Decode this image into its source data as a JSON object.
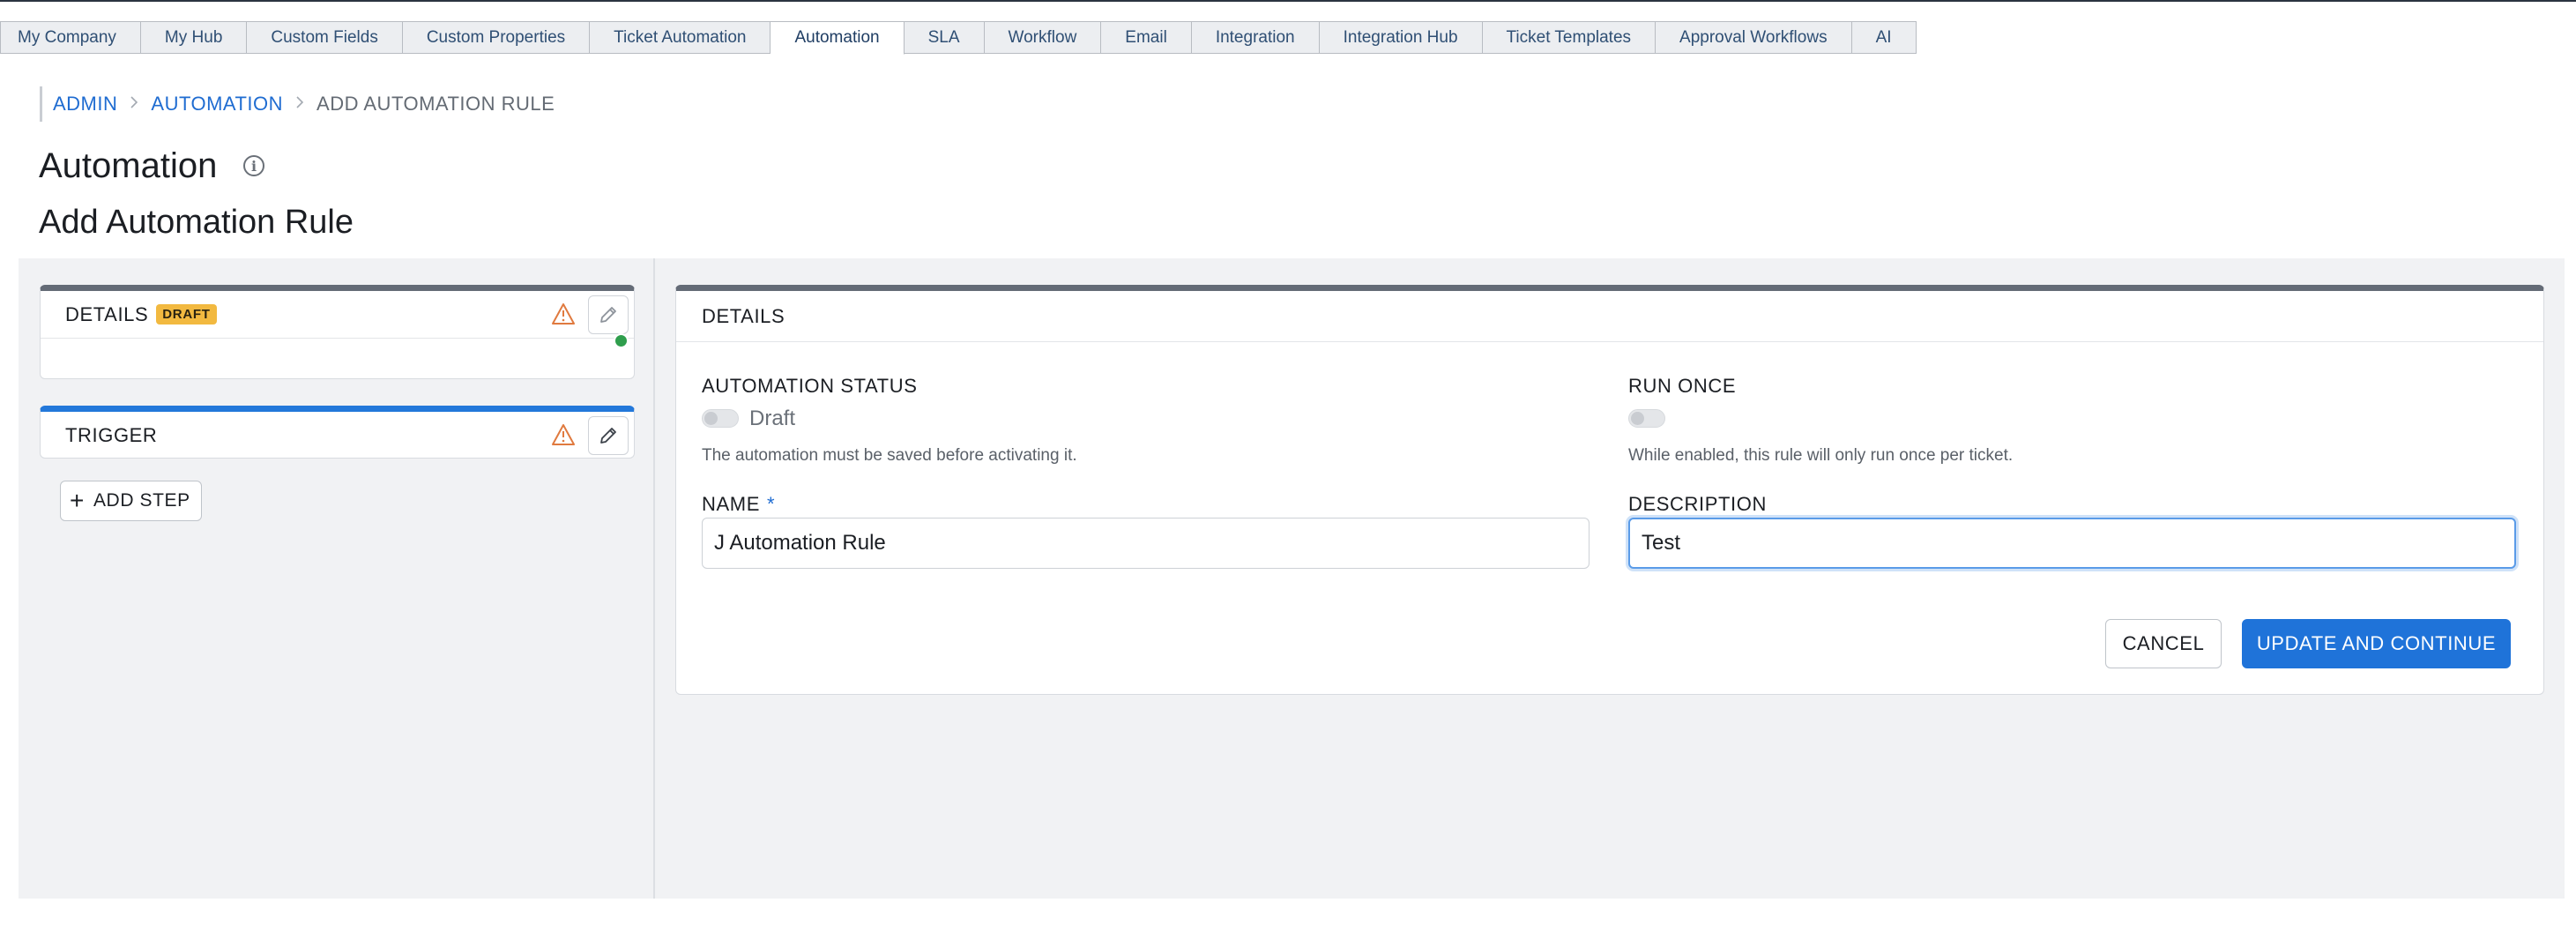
{
  "tabs": [
    {
      "label": "My Company",
      "active": false
    },
    {
      "label": "My Hub",
      "active": false
    },
    {
      "label": "Custom Fields",
      "active": false
    },
    {
      "label": "Custom Properties",
      "active": false
    },
    {
      "label": "Ticket Automation",
      "active": false
    },
    {
      "label": "Automation",
      "active": true
    },
    {
      "label": "SLA",
      "active": false
    },
    {
      "label": "Workflow",
      "active": false
    },
    {
      "label": "Email",
      "active": false
    },
    {
      "label": "Integration",
      "active": false
    },
    {
      "label": "Integration Hub",
      "active": false
    },
    {
      "label": "Ticket Templates",
      "active": false
    },
    {
      "label": "Approval Workflows",
      "active": false
    },
    {
      "label": "AI",
      "active": false
    }
  ],
  "breadcrumb": {
    "items": [
      "ADMIN",
      "AUTOMATION"
    ],
    "current": "ADD AUTOMATION RULE"
  },
  "page": {
    "title": "Automation",
    "subtitle": "Add Automation Rule"
  },
  "steps": {
    "details": {
      "title": "DETAILS",
      "badge": "DRAFT"
    },
    "trigger": {
      "title": "TRIGGER"
    },
    "add_step_label": "ADD STEP"
  },
  "form": {
    "card_title": "DETAILS",
    "automation_status": {
      "label": "AUTOMATION STATUS",
      "toggle_text": "Draft",
      "enabled": false,
      "help": "The automation must be saved before activating it."
    },
    "run_once": {
      "label": "RUN ONCE",
      "enabled": false,
      "help": "While enabled, this rule will only run once per ticket."
    },
    "name": {
      "label": "NAME",
      "required_mark": "*",
      "value": "J Automation Rule"
    },
    "description": {
      "label": "DESCRIPTION",
      "value": "Test"
    },
    "cancel_label": "CANCEL",
    "submit_label": "UPDATE AND CONTINUE"
  },
  "colors": {
    "accent": "#1f73d9",
    "draft_badge": "#f2b940",
    "warning": "#e07a3f",
    "status_dot": "#2f9e4d"
  },
  "icons": {
    "info": "info-icon",
    "warning": "warning-icon",
    "edit": "pencil-icon",
    "add": "plus-icon",
    "breadcrumb_separator": "chevron-right-icon"
  }
}
